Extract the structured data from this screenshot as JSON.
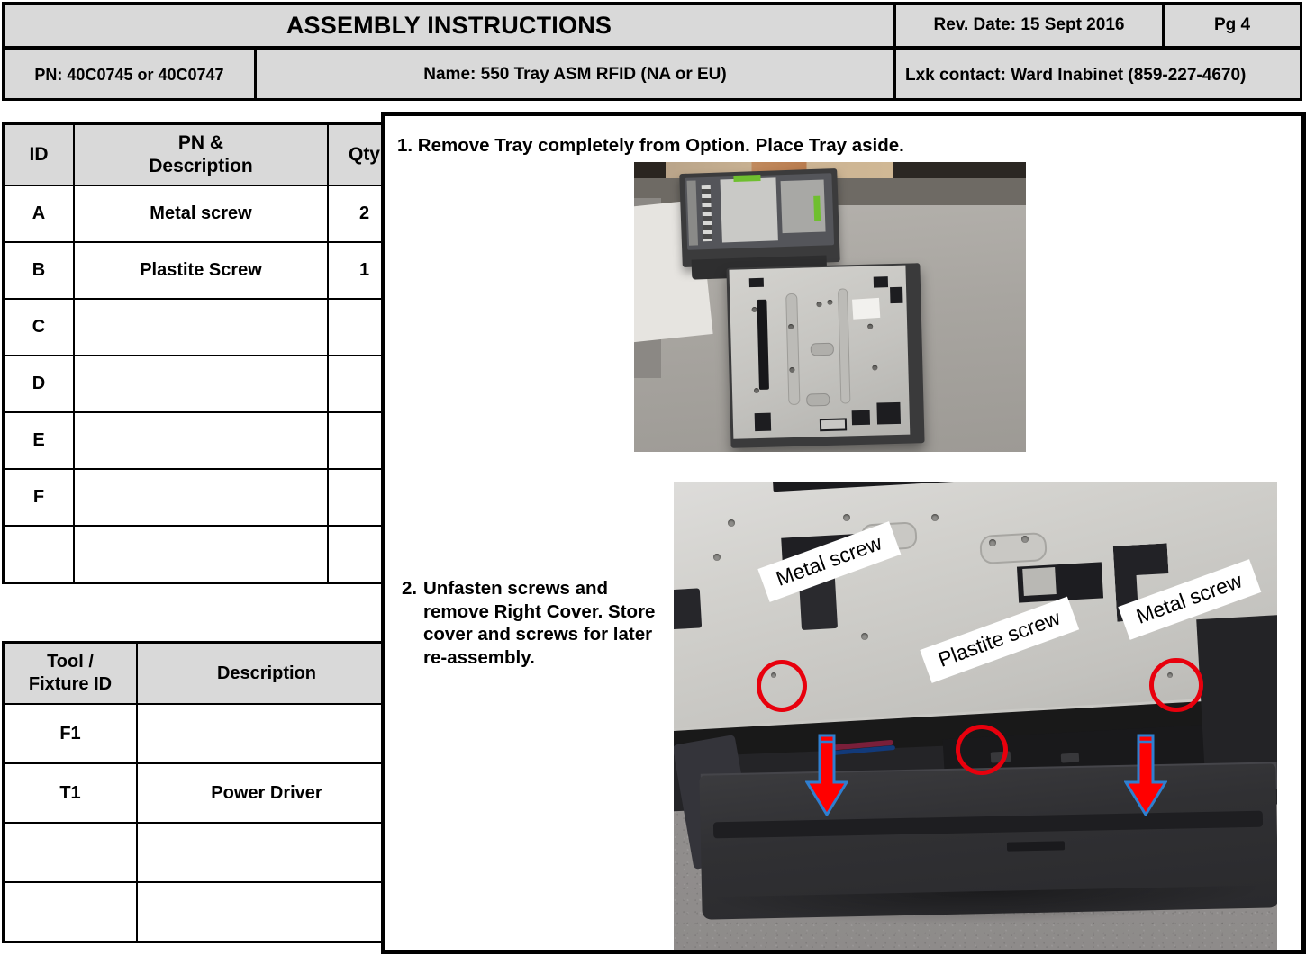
{
  "header": {
    "title": "ASSEMBLY INSTRUCTIONS",
    "rev_date": "Rev. Date: 15 Sept 2016",
    "page": "Pg  4",
    "part_number": "PN:  40C0745 or 40C0747",
    "name": "Name:  550 Tray ASM RFID (NA or EU)",
    "contact": "Lxk contact: Ward Inabinet (859-227-4670)"
  },
  "parts_table": {
    "columns": [
      "ID",
      "PN & Description",
      "Qty"
    ],
    "col_id_label": "ID",
    "col_desc_label": "PN &\nDescription",
    "col_desc_line1": "PN &",
    "col_desc_line2": "Description",
    "col_qty_label": "Qty",
    "rows": [
      {
        "id": "A",
        "description": "Metal screw",
        "qty": "2"
      },
      {
        "id": "B",
        "description": "Plastite Screw",
        "qty": "1"
      },
      {
        "id": "C",
        "description": "",
        "qty": ""
      },
      {
        "id": "D",
        "description": "",
        "qty": ""
      },
      {
        "id": "E",
        "description": "",
        "qty": ""
      },
      {
        "id": "F",
        "description": "",
        "qty": ""
      },
      {
        "id": "",
        "description": "",
        "qty": ""
      }
    ]
  },
  "tool_table": {
    "col_tool_line1": "Tool /",
    "col_tool_line2": "Fixture ID",
    "col_desc_label": "Description",
    "rows": [
      {
        "id": "F1",
        "description": ""
      },
      {
        "id": "T1",
        "description": "Power Driver"
      },
      {
        "id": "",
        "description": ""
      },
      {
        "id": "",
        "description": ""
      }
    ]
  },
  "steps": {
    "step1": "1. Remove Tray completely from Option.  Place Tray aside.",
    "step2_number": "2.",
    "step2_body": "Unfasten screws and remove Right Cover. Store cover and screws for later re-assembly."
  },
  "photo2_annotations": {
    "callout_metal_left": "Metal screw",
    "callout_plastite": "Plastite screw",
    "callout_metal_right": "Metal screw"
  },
  "colors": {
    "header_fill": "#d9d9d9",
    "annotation_red": "#e8000d",
    "annotation_blue": "#2f7fd0",
    "border_black": "#000000"
  }
}
